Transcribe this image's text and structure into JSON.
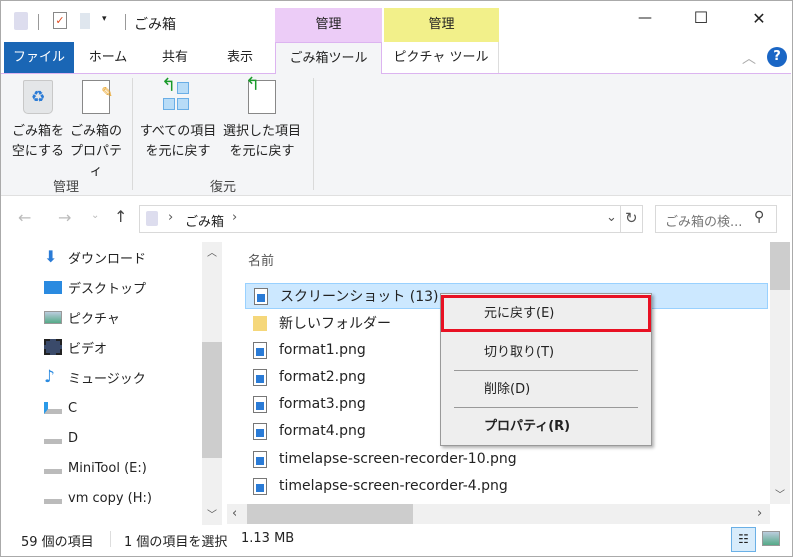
{
  "window": {
    "title": "ごみ箱",
    "minimize": "—",
    "maximize": "☐",
    "close": "✕"
  },
  "context_headers": [
    {
      "label": "管理",
      "color": "#ecccf7"
    },
    {
      "label": "管理",
      "color": "#f2f08a"
    }
  ],
  "tabs": [
    {
      "label": "ファイル"
    },
    {
      "label": "ホーム"
    },
    {
      "label": "共有"
    },
    {
      "label": "表示"
    },
    {
      "label": "ごみ箱ツール",
      "selected": true
    },
    {
      "label": "ピクチャ ツール"
    }
  ],
  "ribbon": {
    "groups": [
      {
        "label": "管理",
        "buttons": [
          {
            "line1": "ごみ箱を",
            "line2": "空にする",
            "icon": "recycle-bin-icon"
          },
          {
            "line1": "ごみ箱の",
            "line2": "プロパティ",
            "icon": "properties-icon"
          }
        ]
      },
      {
        "label": "復元",
        "buttons": [
          {
            "line1": "すべての項目",
            "line2": "を元に戻す",
            "icon": "restore-all-icon"
          },
          {
            "line1": "選択した項目",
            "line2": "を元に戻す",
            "icon": "restore-selected-icon"
          }
        ]
      }
    ]
  },
  "address": {
    "path": "ごみ箱",
    "search_placeholder": "ごみ箱の検..."
  },
  "nav": {
    "items": [
      {
        "label": "ダウンロード",
        "icon": "download-icon"
      },
      {
        "label": "デスクトップ",
        "icon": "desktop-icon"
      },
      {
        "label": "ピクチャ",
        "icon": "pictures-icon"
      },
      {
        "label": "ビデオ",
        "icon": "video-icon"
      },
      {
        "label": "ミュージック",
        "icon": "music-icon"
      },
      {
        "label": "C",
        "icon": "drive-icon"
      },
      {
        "label": "D",
        "icon": "drive-icon"
      },
      {
        "label": "MiniTool (E:)",
        "icon": "drive-icon"
      },
      {
        "label": "vm copy (H:)",
        "icon": "drive-icon"
      }
    ]
  },
  "files": {
    "header": "名前",
    "rows": [
      {
        "name": "スクリーンショット (13).png",
        "selected": true
      },
      {
        "name": "新しいフォルダー",
        "type": "folder"
      },
      {
        "name": "format1.png"
      },
      {
        "name": "format2.png"
      },
      {
        "name": "format3.png"
      },
      {
        "name": "format4.png"
      },
      {
        "name": "timelapse-screen-recorder-10.png"
      },
      {
        "name": "timelapse-screen-recorder-4.png"
      }
    ]
  },
  "context_menu": {
    "items": [
      {
        "label": "元に戻す(E)",
        "highlighted": true
      },
      {
        "label": "切り取り(T)"
      },
      {
        "label": "削除(D)"
      },
      {
        "label": "プロパティ(R)",
        "bold": true
      }
    ]
  },
  "status": {
    "count": "59 個の項目",
    "selection": "1 個の項目を選択",
    "size": "1.13 MB"
  },
  "colors": {
    "file_tab": "#1a66b5",
    "selection": "#cce8ff",
    "highlight_border": "#e81123"
  }
}
